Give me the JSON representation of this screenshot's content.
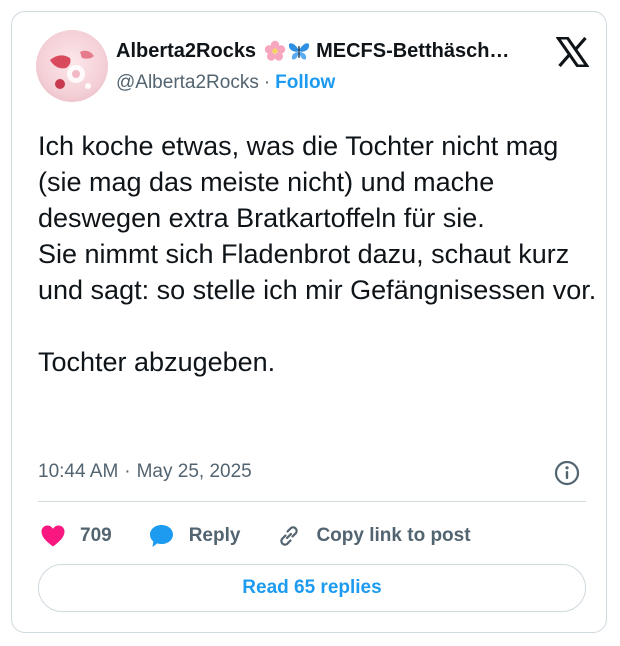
{
  "author": {
    "display_name": "Alberta2Rocks",
    "name_suffix": "MECFS-Betthäsch…",
    "handle": "@Alberta2Rocks",
    "separator": "·",
    "follow_label": "Follow",
    "emojis": [
      "cherry-blossom-icon",
      "butterfly-icon"
    ]
  },
  "tweet": {
    "paragraphs": [
      "Ich koche etwas, was die Tochter nicht mag (sie mag das meiste nicht) und mache deswegen extra Bratkartoffeln für sie.",
      "Sie nimmt sich Fladenbrot dazu, schaut kurz und sagt: so stelle ich mir Gefängnisessen vor.",
      "",
      "Tochter abzugeben."
    ],
    "time": "10:44 AM",
    "date": "May 25, 2025",
    "separator": "·"
  },
  "actions": {
    "like_count": "709",
    "reply_label": "Reply",
    "copy_link_label": "Copy link to post"
  },
  "read_replies_label": "Read 65 replies",
  "colors": {
    "accent": "#1d9bf0",
    "like": "#f91880",
    "text": "#0f1419",
    "muted": "#536471",
    "border": "#cfd9de"
  }
}
